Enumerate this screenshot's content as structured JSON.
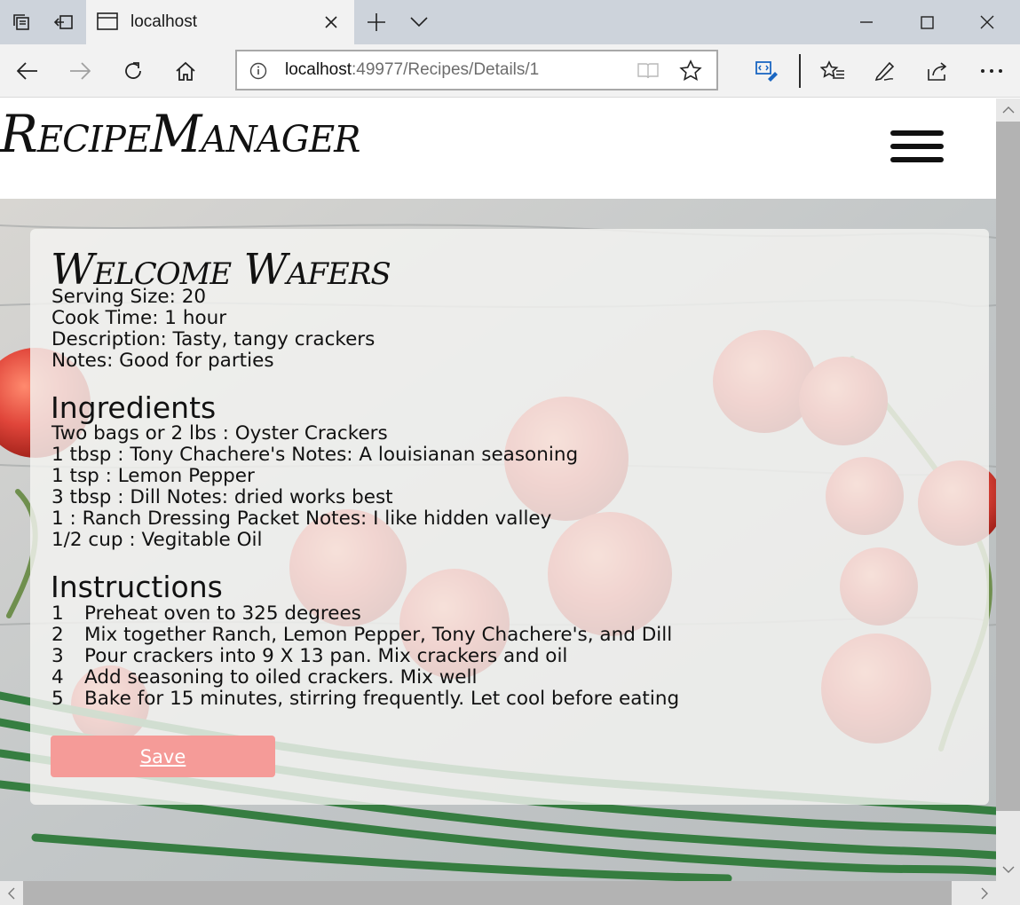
{
  "browser": {
    "tab_title": "localhost",
    "url_host": "localhost",
    "url_path": ":49977/Recipes/Details/1"
  },
  "site": {
    "logo": "RecipeManager"
  },
  "recipe": {
    "title": "Welcome Wafers",
    "details": [
      "Serving Size: 20",
      "Cook Time: 1 hour",
      "Description: Tasty, tangy crackers",
      "Notes: Good for parties"
    ],
    "ingredients_heading": "Ingredients",
    "ingredients": [
      "Two bags or 2 lbs : Oyster Crackers",
      "1 tbsp : Tony Chachere's Notes: A louisianan seasoning",
      "1 tsp : Lemon Pepper",
      "3 tbsp : Dill Notes: dried works best",
      "1 : Ranch Dressing Packet Notes: I like hidden valley",
      "1/2 cup : Vegitable Oil"
    ],
    "instructions_heading": "Instructions",
    "instructions": [
      {
        "n": "1",
        "text": "Preheat oven to 325 degrees"
      },
      {
        "n": "2",
        "text": "Mix together Ranch, Lemon Pepper, Tony Chachere's, and Dill"
      },
      {
        "n": "3",
        "text": "Pour crackers into 9 X 13 pan. Mix crackers and oil"
      },
      {
        "n": "4",
        "text": "Add seasoning to oiled crackers. Mix well"
      },
      {
        "n": "5",
        "text": "Bake for 15 minutes, stirring frequently. Let cool before eating"
      }
    ],
    "save_label": "Save"
  },
  "colors": {
    "save_button": "#f59b98",
    "tomato": "#e0453a",
    "scallion": "#2f7a3a"
  },
  "icons": [
    "tab-actions-icon",
    "set-aside-tabs-icon",
    "tab-page-icon",
    "close-icon",
    "new-tab-icon",
    "chevron-down-icon",
    "minimize-icon",
    "maximize-icon",
    "back-icon",
    "forward-icon",
    "refresh-icon",
    "home-icon",
    "info-icon",
    "reading-view-icon",
    "favorite-star-icon",
    "dev-tools-icon",
    "favorites-list-icon",
    "pen-icon",
    "share-icon",
    "more-icon",
    "hamburger-menu-icon"
  ]
}
